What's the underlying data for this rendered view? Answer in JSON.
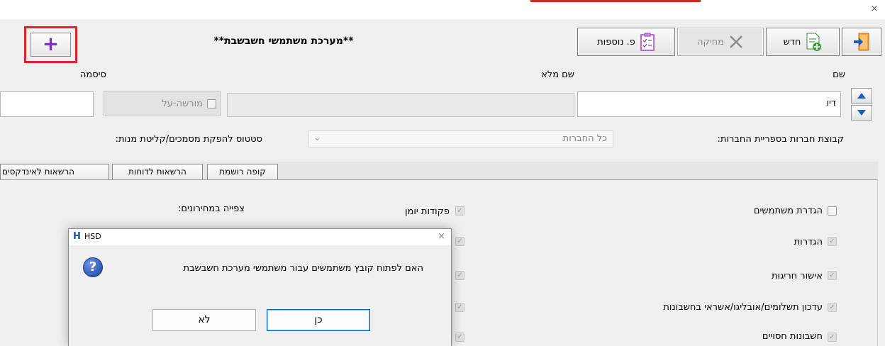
{
  "window": {
    "close_glyph": "×"
  },
  "toolbar": {
    "exit_icon": "exit-door-icon",
    "new_label": "חדש",
    "delete_label": "מחיקה",
    "more_label": "פ. נוספות",
    "add_glyph": "+"
  },
  "header": {
    "title": "**מערכת משתמשי חשבשבת**"
  },
  "form": {
    "name_label": "שם",
    "name_value": "דיו",
    "fullname_label": "שם מלא",
    "fullname_value": "",
    "password_label": "סיסמה",
    "inherit_label": "מורשה-על",
    "company_group_label": "קבוצת חברות בספריית החברות:",
    "company_group_value": "כל החברות",
    "status_label": "סטטוס להפקת מסמכים/קליטת מנות:"
  },
  "tabs": [
    {
      "label": "קופה רושמת"
    },
    {
      "label": "הרשאות לדוחות"
    },
    {
      "label": "הרשאות לאינדקסים"
    }
  ],
  "permissions": {
    "right_column": [
      {
        "label": "הגדרת משתמשים",
        "checked": false
      },
      {
        "label": "הגדרות",
        "checked": true
      },
      {
        "label": "אישור חריגות",
        "checked": true
      },
      {
        "label": "עדכון תשלומים/אובליגו/אשראי בחשבונות",
        "checked": true
      },
      {
        "label": "חשבונות חסויים",
        "checked": true
      }
    ],
    "middle_label": "פקודות יומן",
    "price_view_label": "צפייה במחירונים:"
  },
  "dialog": {
    "title": "HSD",
    "message": "האם לפתוח קובץ משתמשים עבור משתמשי מערכת חשבשבת",
    "yes_label": "כן",
    "no_label": "לא",
    "close_glyph": "×"
  }
}
